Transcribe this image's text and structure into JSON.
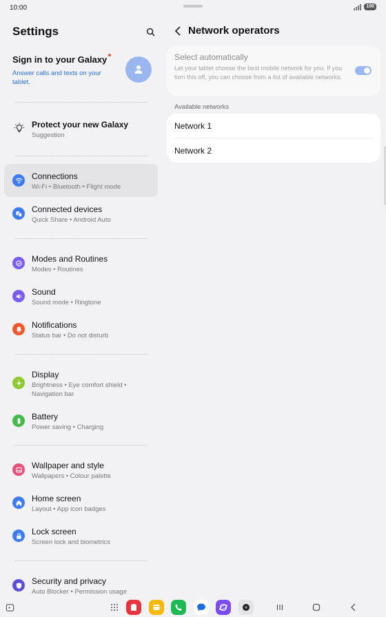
{
  "status": {
    "time": "10:00",
    "battery": "100"
  },
  "left": {
    "title": "Settings",
    "signin": {
      "title": "Sign in to your Galaxy",
      "subtitle": "Answer calls and texts on your tablet."
    },
    "suggestion": {
      "title": "Protect your new Galaxy",
      "subtitle": "Suggestion"
    },
    "items": [
      {
        "title": "Connections",
        "subtitle": "Wi-Fi  •  Bluetooth  •  Flight mode",
        "icon": "wifi-icon",
        "color": "#3e7bf3"
      },
      {
        "title": "Connected devices",
        "subtitle": "Quick Share  •  Android Auto",
        "icon": "devices-icon",
        "color": "#3e7bf3"
      },
      {
        "title": "Modes and Routines",
        "subtitle": "Modes  •  Routines",
        "icon": "modes-icon",
        "color": "#7a5cf0"
      },
      {
        "title": "Sound",
        "subtitle": "Sound mode  •  Ringtone",
        "icon": "sound-icon",
        "color": "#7a5cf0"
      },
      {
        "title": "Notifications",
        "subtitle": "Status bar  •  Do not disturb",
        "icon": "bell-icon",
        "color": "#f0582b"
      },
      {
        "title": "Display",
        "subtitle": "Brightness  •  Eye comfort shield  •  Navigation bar",
        "icon": "sun-icon",
        "color": "#8bc92e"
      },
      {
        "title": "Battery",
        "subtitle": "Power saving  •  Charging",
        "icon": "battery-icon",
        "color": "#45b94a"
      },
      {
        "title": "Wallpaper and style",
        "subtitle": "Wallpapers  •  Colour palette",
        "icon": "wallpaper-icon",
        "color": "#e8507a"
      },
      {
        "title": "Home screen",
        "subtitle": "Layout  •  App icon badges",
        "icon": "home-icon",
        "color": "#3e7bf3"
      },
      {
        "title": "Lock screen",
        "subtitle": "Screen lock and biometrics",
        "icon": "lock-icon",
        "color": "#3e7bf3"
      },
      {
        "title": "Security and privacy",
        "subtitle": "Auto Blocker  •  Permission usage",
        "icon": "shield-icon",
        "color": "#5b4fd6"
      }
    ]
  },
  "right": {
    "title": "Network operators",
    "auto": {
      "title": "Select automatically",
      "description": "Let your tablet choose the best mobile network for you. If you turn this off, you can choose from a list of available networks.",
      "enabled": true
    },
    "section_label": "Available networks",
    "networks": [
      "Network 1",
      "Network 2"
    ]
  },
  "colors": {
    "accent": "#3e7bf3",
    "background": "#f2f2f4",
    "card": "#ffffff"
  }
}
